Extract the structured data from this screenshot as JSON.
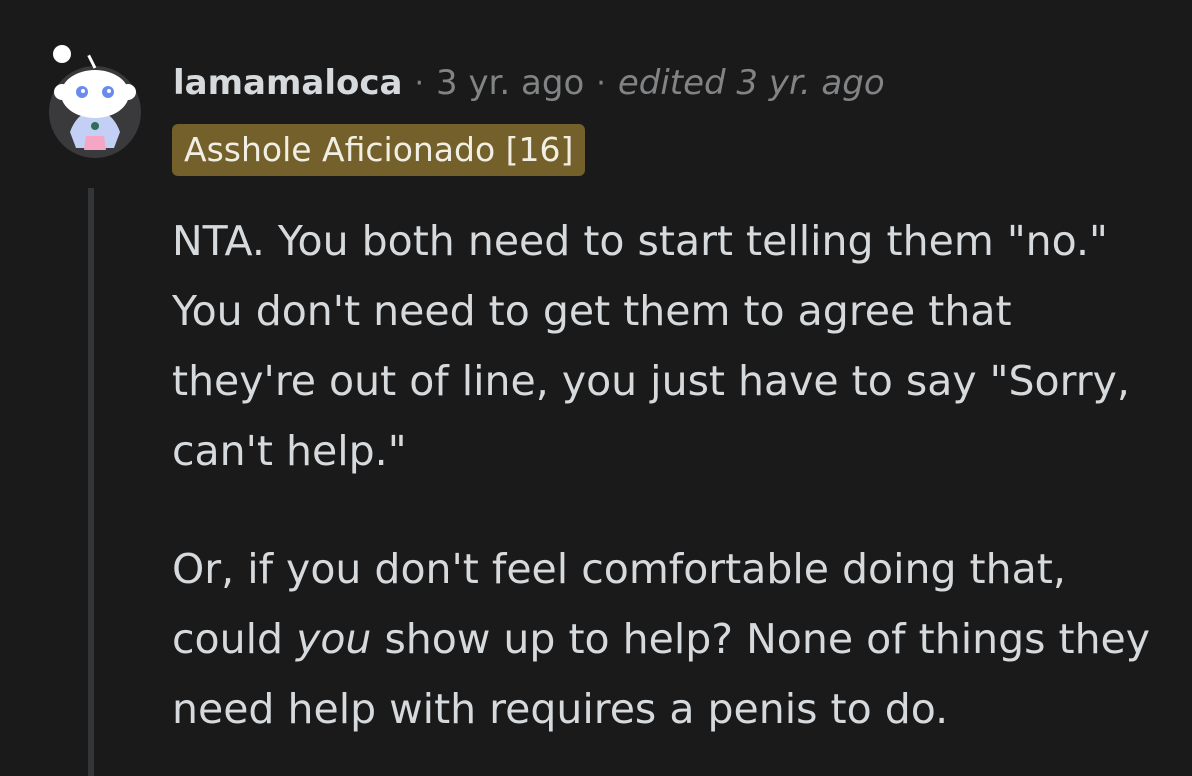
{
  "comment": {
    "avatar_icon": "snoo-avatar-icon",
    "username": "lamamaloca",
    "separator": "·",
    "time": "3 yr. ago",
    "edited": "edited 3 yr. ago",
    "flair": "Asshole Aficionado [16]",
    "paragraph1": "NTA. You both need to start telling them \"no.\" You don't need to get them to agree that they're out of line, you just have to say \"Sorry, can't help.\"",
    "paragraph2_before": "Or, if you don't feel comfortable doing that, could ",
    "paragraph2_emphasis": "you",
    "paragraph2_after": " show up to help? None of things they need help with requires a penis to do."
  },
  "colors": {
    "background": "#1a1a1b",
    "text": "#d7dadc",
    "meta": "#818384",
    "flair_bg": "#74602a",
    "thread_line": "#343536"
  }
}
